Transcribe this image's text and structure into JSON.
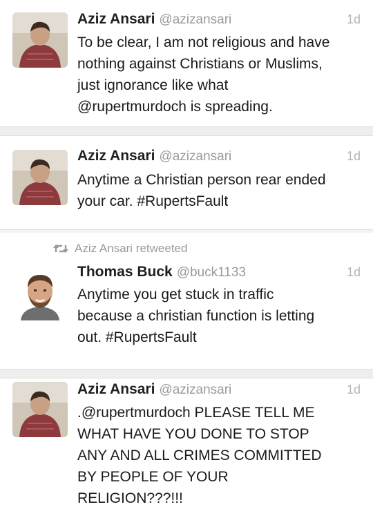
{
  "colors": {
    "name": "#1f1f1f",
    "handle": "#9a9a9a",
    "time": "#b5b5b5",
    "text": "#1a1a1a",
    "separator": "#eeeeee"
  },
  "tweets": [
    {
      "display_name": "Aziz Ansari",
      "handle": "@azizansari",
      "time": "1d",
      "avatar_icon": "child-in-red-jacket-avatar",
      "lines": [
        "To be clear, I am not religious and have",
        "nothing against Christians or Muslims,",
        "just ignorance like what",
        "@rupertmurdoch is spreading."
      ]
    },
    {
      "display_name": "Aziz Ansari",
      "handle": "@azizansari",
      "time": "1d",
      "avatar_icon": "child-in-red-jacket-avatar",
      "lines": [
        "Anytime a Christian person rear ended",
        "your car. #RupertsFault"
      ]
    },
    {
      "retweeted_by": "Aziz Ansari retweeted",
      "retweet_icon": "retweet-icon",
      "display_name": "Thomas Buck",
      "handle": "@buck1133",
      "time": "1d",
      "avatar_icon": "man-portrait-avatar",
      "lines": [
        "Anytime you get stuck in traffic",
        "because a christian function is letting",
        "out. #RupertsFault"
      ]
    },
    {
      "display_name": "Aziz Ansari",
      "handle": "@azizansari",
      "time": "1d",
      "avatar_icon": "child-in-red-jacket-avatar",
      "lines": [
        ".@rupertmurdoch PLEASE TELL ME",
        "WHAT HAVE YOU DONE TO STOP",
        "ANY AND ALL CRIMES COMMITTED",
        "BY PEOPLE OF YOUR",
        "RELIGION???!!!"
      ]
    }
  ]
}
